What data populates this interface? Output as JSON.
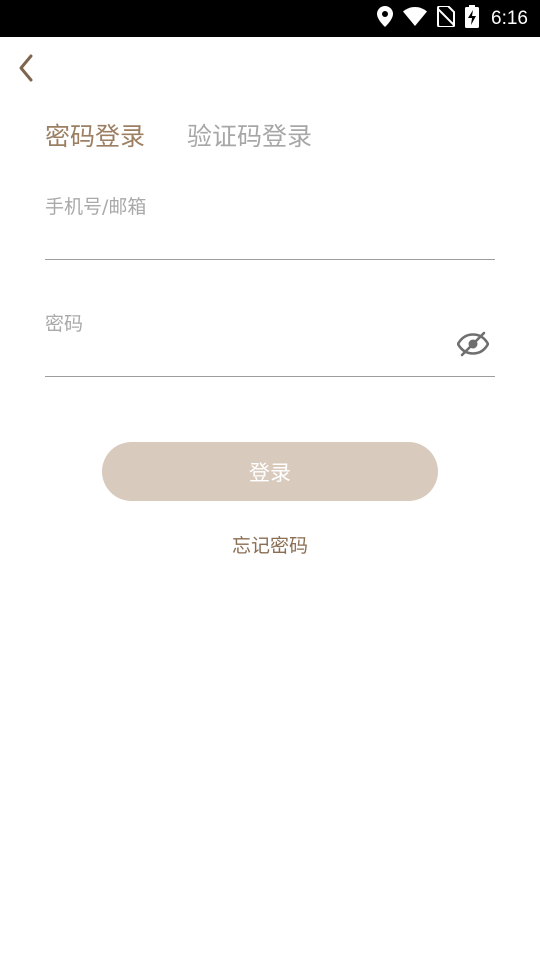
{
  "status_bar": {
    "time": "6:16",
    "icons": [
      "location-icon",
      "wifi-icon",
      "no-sim-icon",
      "battery-charging-icon"
    ]
  },
  "nav": {
    "back_icon": "chevron-left-icon"
  },
  "tabs": [
    {
      "label": "密码登录",
      "active": true
    },
    {
      "label": "验证码登录",
      "active": false
    }
  ],
  "form": {
    "account_label": "手机号/邮箱",
    "account_value": "",
    "password_label": "密码",
    "password_value": "",
    "password_toggle_icon": "eye-off-icon"
  },
  "actions": {
    "login_label": "登录",
    "forgot_label": "忘记密码"
  },
  "colors": {
    "accent": "#9c7f63",
    "inactive_tab": "#a7a7a7",
    "button_bg": "#d8cabd",
    "link": "#8a6d52"
  }
}
